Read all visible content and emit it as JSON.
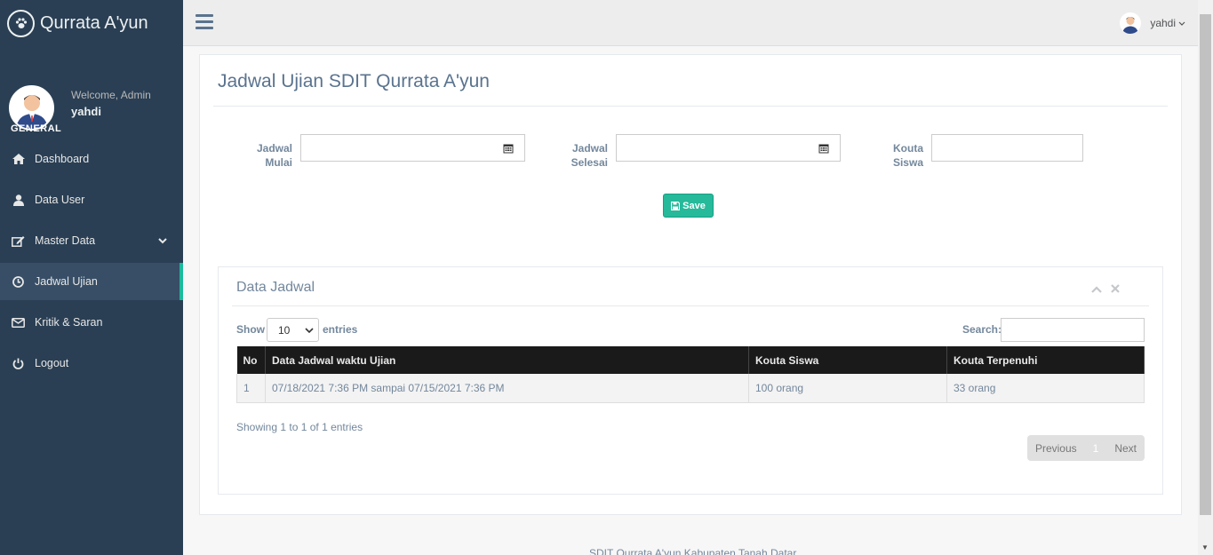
{
  "brand": {
    "title": "Qurrata A'yun",
    "logo_icon": "paw-icon"
  },
  "profile": {
    "welcome": "Welcome, Admin",
    "name": "yahdi"
  },
  "sidebar": {
    "section": "GENERAL",
    "items": [
      {
        "label": "Dashboard",
        "icon": "home-icon"
      },
      {
        "label": "Data User",
        "icon": "user-icon"
      },
      {
        "label": "Master Data",
        "icon": "edit-icon"
      },
      {
        "label": "Jadwal Ujian",
        "icon": "clock-icon",
        "active": true
      },
      {
        "label": "Kritik & Saran",
        "icon": "envelope-icon"
      },
      {
        "label": "Logout",
        "icon": "power-icon"
      }
    ]
  },
  "topnav": {
    "username": "yahdi",
    "caret": "⌄"
  },
  "page": {
    "title": "Jadwal Ujian SDIT Qurrata A'yun"
  },
  "form": {
    "start_label_1": "Jadwal",
    "start_label_2": "Mulai",
    "end_label_1": "Jadwal",
    "end_label_2": "Selesai",
    "quota_label_1": "Kouta",
    "quota_label_2": "Siswa",
    "save_label": "Save"
  },
  "data_box": {
    "title": "Data Jadwal",
    "show_label": "Show",
    "entries_value": "10",
    "entries_label": "entries",
    "search_label": "Search:",
    "columns": [
      "No",
      "Data Jadwal waktu Ujian",
      "Kouta Siswa",
      "Kouta Terpenuhi"
    ],
    "rows": [
      [
        "1",
        "07/18/2021 7:36 PM sampai 07/15/2021 7:36 PM",
        "100 orang",
        "33 orang"
      ]
    ],
    "info": "Showing 1 to 1 of 1 entries",
    "pager": {
      "previous": "Previous",
      "current": "1",
      "next": "Next"
    }
  },
  "footer": {
    "text": "SDIT Qurrata A'yun Kabupaten Tanah Datar"
  },
  "colors": {
    "sidebar": "#2A3F54",
    "accent": "#1ABB9C",
    "save": "#26B99A"
  }
}
